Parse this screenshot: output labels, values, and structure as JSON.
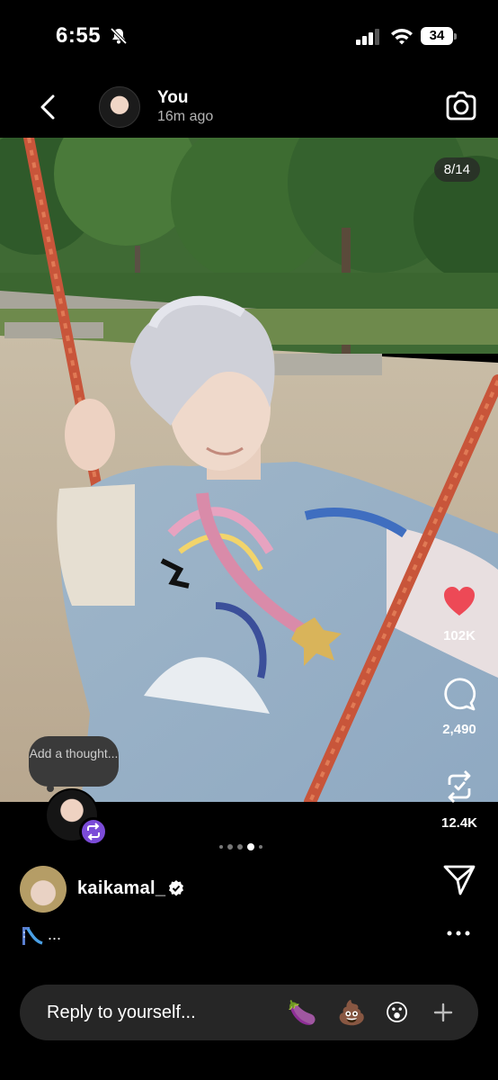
{
  "status": {
    "time": "6:55",
    "battery": "34"
  },
  "header": {
    "name": "You",
    "time_ago": "16m ago"
  },
  "photo": {
    "counter": "8/14"
  },
  "rail": {
    "likes": "102K",
    "comments": "2,490",
    "reposts": "12.4K",
    "like_color": "#ed4956"
  },
  "thought": {
    "label": "Add a thought..."
  },
  "author": {
    "username": "kaikamal_",
    "caption_suffix": "..."
  },
  "reply": {
    "placeholder": "Reply to yourself...",
    "emojis": [
      "🍆",
      "💩",
      "😮"
    ]
  },
  "icons": {
    "back": "chevron-left-icon",
    "camera": "camera-icon",
    "like": "heart-icon",
    "comment": "comment-bubble-icon",
    "repost": "repost-icon",
    "share": "send-icon",
    "more": "more-icon"
  }
}
